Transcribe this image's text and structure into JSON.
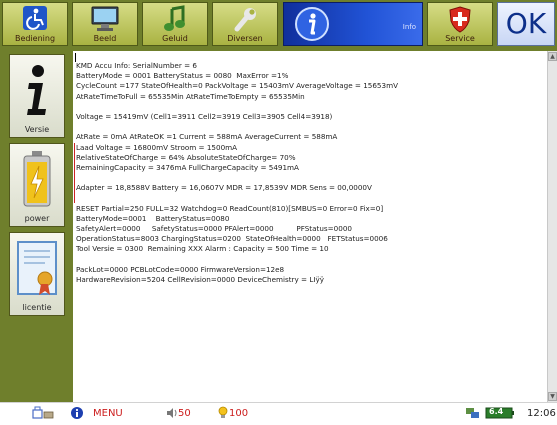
{
  "toolbar": {
    "items": [
      {
        "label": "Bediening",
        "icon": "wheelchair-icon"
      },
      {
        "label": "Beeld",
        "icon": "monitor-icon"
      },
      {
        "label": "Geluid",
        "icon": "music-note-icon"
      },
      {
        "label": "Diversen",
        "icon": "wrench-icon"
      }
    ],
    "info": {
      "label": "Info",
      "icon": "info-icon"
    },
    "service": {
      "label": "Service",
      "icon": "shield-icon"
    },
    "ok_label": "OK"
  },
  "sidebar": {
    "items": [
      {
        "label": "Versie",
        "icon": "info-icon"
      },
      {
        "label": "power",
        "icon": "battery-icon"
      },
      {
        "label": "licentie",
        "icon": "certificate-icon"
      }
    ]
  },
  "panel": {
    "lines": [
      "KMD Accu Info: SerialNumber = 6",
      "BatteryMode = 0001 BatteryStatus = 0080  MaxError =1%",
      "CycleCount =177 StateOfHealth=0 PackVoltage = 15403mV AverageVoltage = 15653mV",
      "AtRateTimeToFull = 65535Min AtRateTimeToEmpty = 65535Min",
      "",
      "Voltage = 15419mV (Cell1=3911 Cell2=3919 Cell3=3905 Cell4=3918)",
      "",
      "AtRate = 0mA AtRateOK =1 Current = 588mA AverageCurrent = 588mA",
      "Laad Voltage = 16800mV Stroom = 1500mA",
      "RelativeStateOfCharge = 64% AbsoluteStateOfCharge= 70%",
      "RemainingCapacity = 3476mA FullChargeCapacity = 5491mA",
      "",
      "Adapter = 18,8588V Battery = 16,0607V MDR = 17,8539V MDR Sens = 00,0000V",
      "",
      "RESET Partial=250 FULL=32 Watchdog=0 ReadCount(810)[SMBUS=0 Error=0 Fix=0]",
      "BatteryMode=0001    BatteryStatus=0080",
      "SafetyAlert=0000     SafetyStatus=0000 PFAlert=0000          PFStatus=0000",
      "OperationStatus=8003 ChargingStatus=0200  StateOfHealth=0000   FETStatus=0006",
      "Tool Versie = 0300  Remaining XXX Alarm : Capacity = 500 Time = 10",
      "",
      "PackLot=0000 PCBLotCode=0000 FirmwareVersion=12e8",
      "HardwareRevision=5204 CellRevision=0000 DeviceChemistry = LIÿÿ"
    ]
  },
  "taskbar": {
    "menu_label": "MENU",
    "volume_value": "50",
    "brightness_value": "100",
    "clock": "12:06",
    "battery_tray": "6.4"
  },
  "colors": {
    "background": "#6f7f2c",
    "info_blue": "#2153d6",
    "taskbar_red": "#cc1d1d"
  }
}
